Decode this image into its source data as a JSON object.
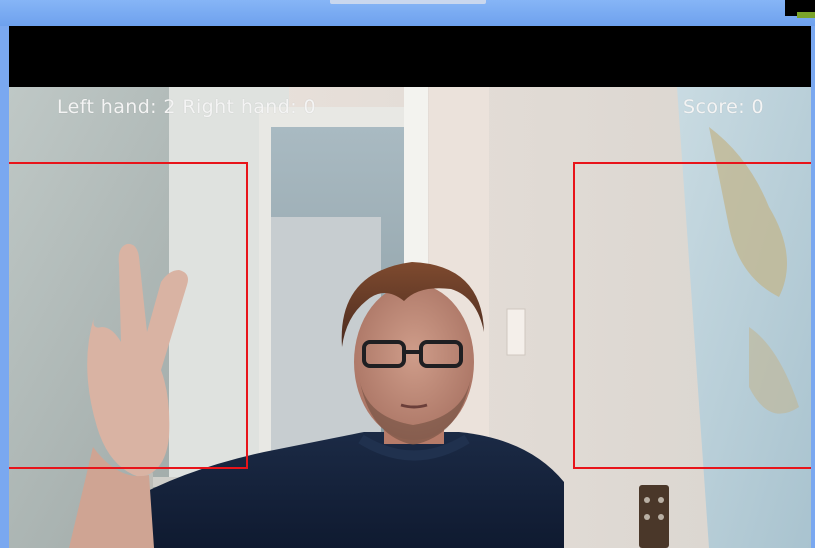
{
  "overlay": {
    "hand_count_text": "Left hand: 2 Right hand: 0",
    "score_text": "Score: 0"
  },
  "colors": {
    "window_blue": "#7fb0f4",
    "roi_red": "#e8141a",
    "overlay_text": "#f4f4f4"
  },
  "icons": {
    "camera_feed": "webcam-scene"
  }
}
